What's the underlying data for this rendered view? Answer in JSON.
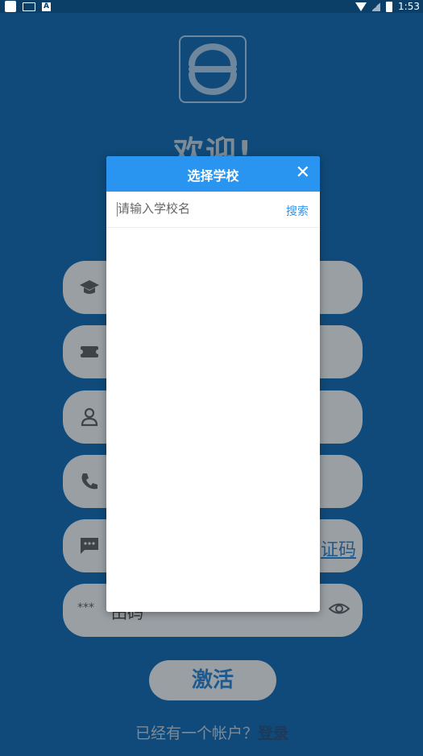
{
  "status_bar": {
    "time": "1:53",
    "keyboard_label": "A"
  },
  "welcome": "欢迎!",
  "fields": [
    {
      "icon": "graduation-cap-icon"
    },
    {
      "icon": "ticket-icon"
    },
    {
      "icon": "person-icon"
    },
    {
      "icon": "phone-icon"
    },
    {
      "icon": "message-icon",
      "tail": "证码"
    },
    {
      "icon": "password-icon",
      "stars": "***",
      "text": "田码",
      "eye": "eye-icon"
    }
  ],
  "activate_label": "激活",
  "footer": {
    "prefix": "已经有一个帐户？",
    "login": "登录"
  },
  "dialog": {
    "title": "选择学校",
    "search_placeholder": "请输入学校名",
    "search_label": "搜索",
    "close_glyph": "✕"
  },
  "colors": {
    "background": "#0f4a7a",
    "accent": "#2a95f0",
    "field": "#9a9fa4"
  }
}
